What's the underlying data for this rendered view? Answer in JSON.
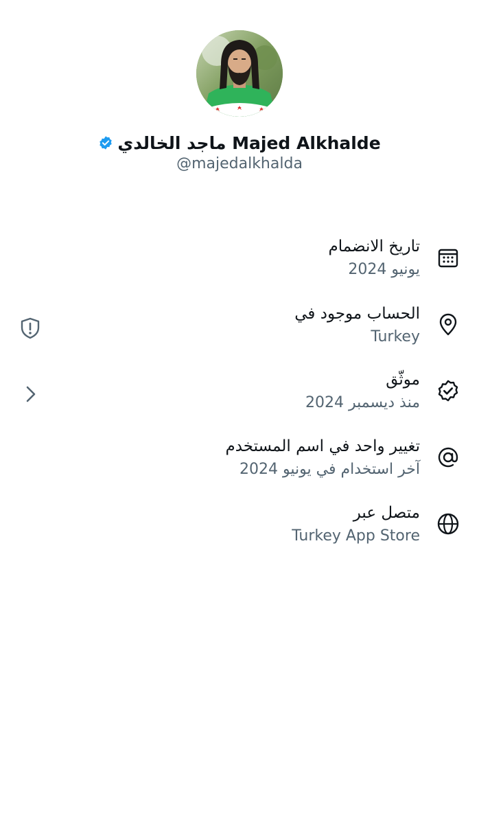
{
  "profile": {
    "display_name": "ماجد الخالدي Majed Alkhalde",
    "handle": "@majedalkhalda",
    "verified_color": "#1d9bf0",
    "avatar_icon": "profile-photo"
  },
  "about_items": [
    {
      "icon": "calendar-icon",
      "title": "تاريخ الانضمام",
      "subtitle": "يونيو 2024"
    },
    {
      "icon": "location-pin-icon",
      "title": "الحساب موجود في",
      "subtitle": "Turkey",
      "side_icon": "shield-alert-icon"
    },
    {
      "icon": "verified-badge-icon",
      "title": "موثّق",
      "subtitle": "منذ ديسمبر 2024",
      "side_icon": "chevron-right-icon"
    },
    {
      "icon": "at-sign-icon",
      "title": "تغيير واحد في اسم المستخدم",
      "subtitle": "آخر استخدام في يونيو 2024"
    },
    {
      "icon": "globe-icon",
      "title": "متصل عبر",
      "subtitle": "Turkey App Store"
    }
  ]
}
